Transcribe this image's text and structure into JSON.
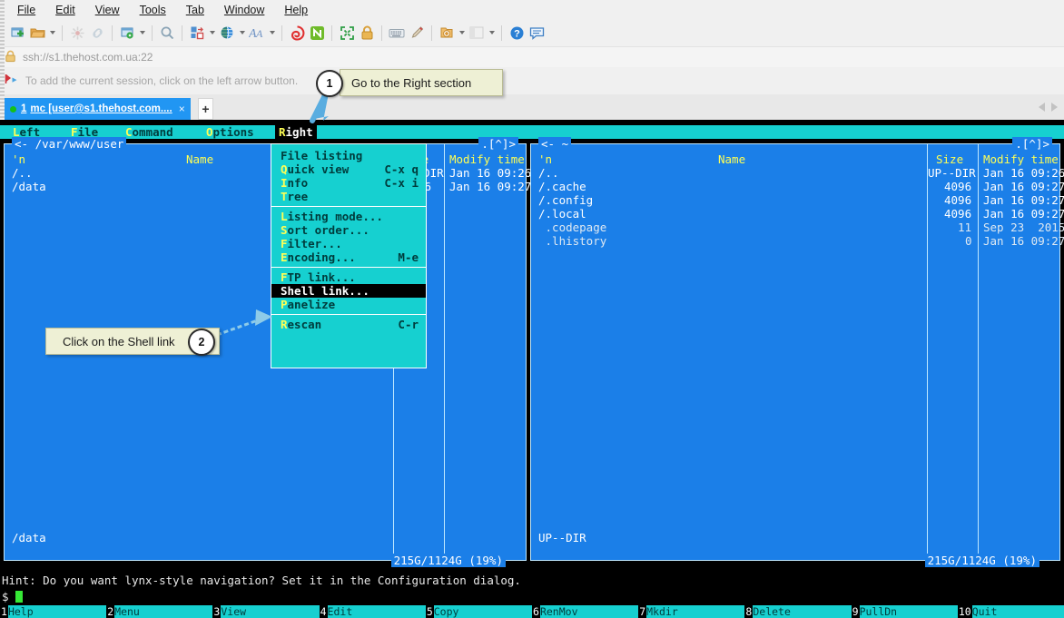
{
  "window": {
    "menus": [
      "File",
      "Edit",
      "View",
      "Tools",
      "Tab",
      "Window",
      "Help"
    ],
    "toolbar_icons": [
      "new-session-icon",
      "open-folder-icon",
      "open-folder-dropdown-arrow",
      "sep",
      "clone-session-icon",
      "chain-link-icon",
      "sep",
      "session-settings-icon",
      "session-settings-dropdown-arrow",
      "sep",
      "search-icon",
      "sep",
      "transfer-icon",
      "transfer-dropdown-arrow",
      "globe-icon",
      "globe-dropdown-arrow",
      "font-icon",
      "font-dropdown-arrow",
      "sep",
      "putty-icon",
      "n-logo-icon",
      "sep",
      "fullscreen-icon",
      "lock-icon",
      "sep",
      "keyboard-icon",
      "pen-icon",
      "sep",
      "add-file-icon",
      "add-file-dropdown-arrow",
      "layout-icon",
      "layout-dropdown-arrow",
      "sep",
      "help-icon",
      "comment-icon"
    ],
    "url": "ssh://s1.thehost.com.ua:22",
    "session_hint": "To add the current session, click on the left arrow button.",
    "tab": {
      "index": "1",
      "title": "mc [user@s1.thehost.com....",
      "close": "×"
    },
    "new_tab_label": "+"
  },
  "mc": {
    "menubar": [
      {
        "label": "Left",
        "hotkey": "L",
        "active": false
      },
      {
        "label": "File",
        "hotkey": "F",
        "active": false
      },
      {
        "label": "Command",
        "hotkey": "C",
        "active": false
      },
      {
        "label": "Options",
        "hotkey": "O",
        "active": false
      },
      {
        "label": "Right",
        "hotkey": "R",
        "active": true
      }
    ],
    "dropdown": {
      "title": "Right",
      "groups": [
        [
          {
            "label": "File listing",
            "hotkey": "",
            "key": "",
            "selected": false
          },
          {
            "label": "Quick view",
            "hotkey": "Q",
            "key": "C-x q",
            "selected": false
          },
          {
            "label": "Info",
            "hotkey": "I",
            "key": "C-x i",
            "selected": false
          },
          {
            "label": "Tree",
            "hotkey": "T",
            "key": "",
            "selected": false
          }
        ],
        [
          {
            "label": "Listing mode...",
            "hotkey": "L",
            "key": "",
            "selected": false
          },
          {
            "label": "Sort order...",
            "hotkey": "S",
            "key": "",
            "selected": false
          },
          {
            "label": "Filter...",
            "hotkey": "F",
            "key": "",
            "selected": false
          },
          {
            "label": "Encoding...",
            "hotkey": "E",
            "key": "M-e",
            "selected": false
          }
        ],
        [
          {
            "label": "FTP link...",
            "hotkey": "F",
            "key": "",
            "selected": false
          },
          {
            "label": "Shell link...",
            "hotkey": "S",
            "key": "",
            "selected": true
          },
          {
            "label": "Panelize",
            "hotkey": "P",
            "key": "",
            "selected": false
          }
        ],
        [
          {
            "label": "Rescan",
            "hotkey": "R",
            "key": "C-r",
            "selected": false
          }
        ]
      ]
    },
    "left_panel": {
      "title": "<- /var/www/user",
      "corner": ".[^]>",
      "headers": {
        "name_mark": "'n",
        "name": "Name",
        "size": "Size",
        "time": "Modify time"
      },
      "rows": [
        {
          "name": "/..",
          "size": "UP--DIR",
          "time": "Jan 16 09:26",
          "dim": false
        },
        {
          "name": "/data",
          "size": "96",
          "time": "Jan 16 09:27",
          "dim": false
        }
      ],
      "status": "/data",
      "fs_info": "215G/1124G (19%)"
    },
    "right_panel": {
      "title": "<- ~",
      "corner": ".[^]>",
      "headers": {
        "name_mark": "'n",
        "name": "Name",
        "size": "Size",
        "time": "Modify time"
      },
      "rows": [
        {
          "name": "/..",
          "size": "UP--DIR",
          "time": "Jan 16 09:26",
          "dim": false
        },
        {
          "name": "/.cache",
          "size": "4096",
          "time": "Jan 16 09:27",
          "dim": false
        },
        {
          "name": "/.config",
          "size": "4096",
          "time": "Jan 16 09:27",
          "dim": false
        },
        {
          "name": "/.local",
          "size": "4096",
          "time": "Jan 16 09:27",
          "dim": false
        },
        {
          "name": " .codepage",
          "size": "11",
          "time": "Sep 23  2015",
          "dim": true
        },
        {
          "name": " .lhistory",
          "size": "0",
          "time": "Jan 16 09:27",
          "dim": true
        }
      ],
      "status": "UP--DIR",
      "fs_info": "215G/1124G (19%)"
    },
    "hint": "Hint: Do you want lynx-style navigation? Set it in the Configuration dialog.",
    "prompt": "$ ",
    "fkeys": [
      {
        "n": "1",
        "label": "Help"
      },
      {
        "n": "2",
        "label": "Menu"
      },
      {
        "n": "3",
        "label": "View"
      },
      {
        "n": "4",
        "label": "Edit"
      },
      {
        "n": "5",
        "label": "Copy"
      },
      {
        "n": "6",
        "label": "RenMov"
      },
      {
        "n": "7",
        "label": "Mkdir"
      },
      {
        "n": "8",
        "label": "Delete"
      },
      {
        "n": "9",
        "label": "PullDn"
      },
      {
        "n": "10",
        "label": "Quit"
      }
    ]
  },
  "callouts": [
    {
      "num": "1",
      "text": "Go to the Right section"
    },
    {
      "num": "2",
      "text": "Click on the Shell link"
    }
  ],
  "colors": {
    "panel_bg": "#1b7fe8",
    "menu_bg": "#16d0d0",
    "accent_yellow": "#ffff55",
    "tab_blue": "#2196f3",
    "callout_bg": "#eef0d5",
    "arrow_blue": "#5aade0"
  }
}
